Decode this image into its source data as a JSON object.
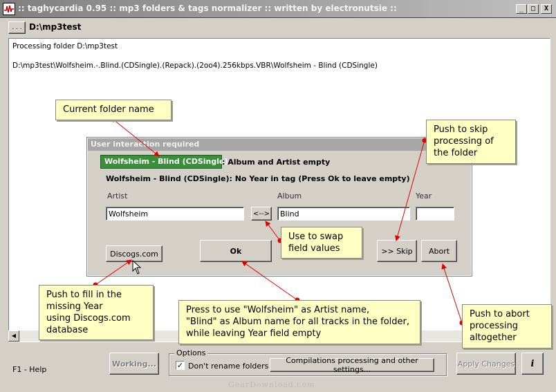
{
  "window": {
    "title": ":: taghycardia 0.95 :: mp3 folders & tags normalizer :: written by electronutsie ::",
    "minimize": "_",
    "maximize": "□",
    "close": "X"
  },
  "toolbar": {
    "browse_label": ". . .",
    "current_path": "D:\\mp3test"
  },
  "log": {
    "lines": [
      "Processing folder D:\\mp3test",
      "D:\\mp3test\\Wolfsheim.-.Blind.(CDSingle).(Repack).(2oo4).256kbps.VBR\\Wolfsheim - Blind (CDSingle)"
    ]
  },
  "dialog": {
    "title": "User interaction required",
    "highlight_folder": "Wolfsheim - Blind (CDSingle)",
    "message1_suffix": ": Album and Artist empty",
    "message2": "Wolfsheim - Blind (CDSingle): No Year in tag (Press Ok to leave empty)",
    "artist_label": "Artist",
    "album_label": "Album",
    "year_label": "Year",
    "artist_value": "Wolfsheim",
    "album_value": "Blind",
    "year_value": "",
    "swap_label": "<-->",
    "discogs_label": "Discogs.com",
    "ok_label": "Ok",
    "skip_label": ">> Skip",
    "abort_label": "Abort"
  },
  "callouts": {
    "current_folder": [
      "Current folder name"
    ],
    "skip": [
      "Push to skip",
      "processing of",
      "the folder"
    ],
    "swap": [
      "Use to swap",
      "field values"
    ],
    "discogs": [
      "Push to fill in the",
      "missing Year",
      "using Discogs.com",
      "database"
    ],
    "ok": [
      "Press to use \"Wolfsheim\" as Artist name,",
      "\"Blind\" as Album name for all tracks in the folder,",
      "while leaving Year field empty"
    ],
    "abort": [
      "Push to abort",
      "processing",
      "altogether"
    ]
  },
  "bottom": {
    "f1_help": "F1 - Help",
    "working_label": "Working...",
    "options_legend": "Options",
    "dont_rename_label": "Don't rename folders",
    "dont_rename_checked": "✓",
    "compilations_label": "Compilations processing and other settings...",
    "apply_label": "Apply Changes",
    "info_label": "i"
  },
  "watermark": "GearDownload.com",
  "colors": {
    "highlight": "#3a8f3a",
    "callout": "#ffffc4",
    "arrow": "#e00000"
  }
}
